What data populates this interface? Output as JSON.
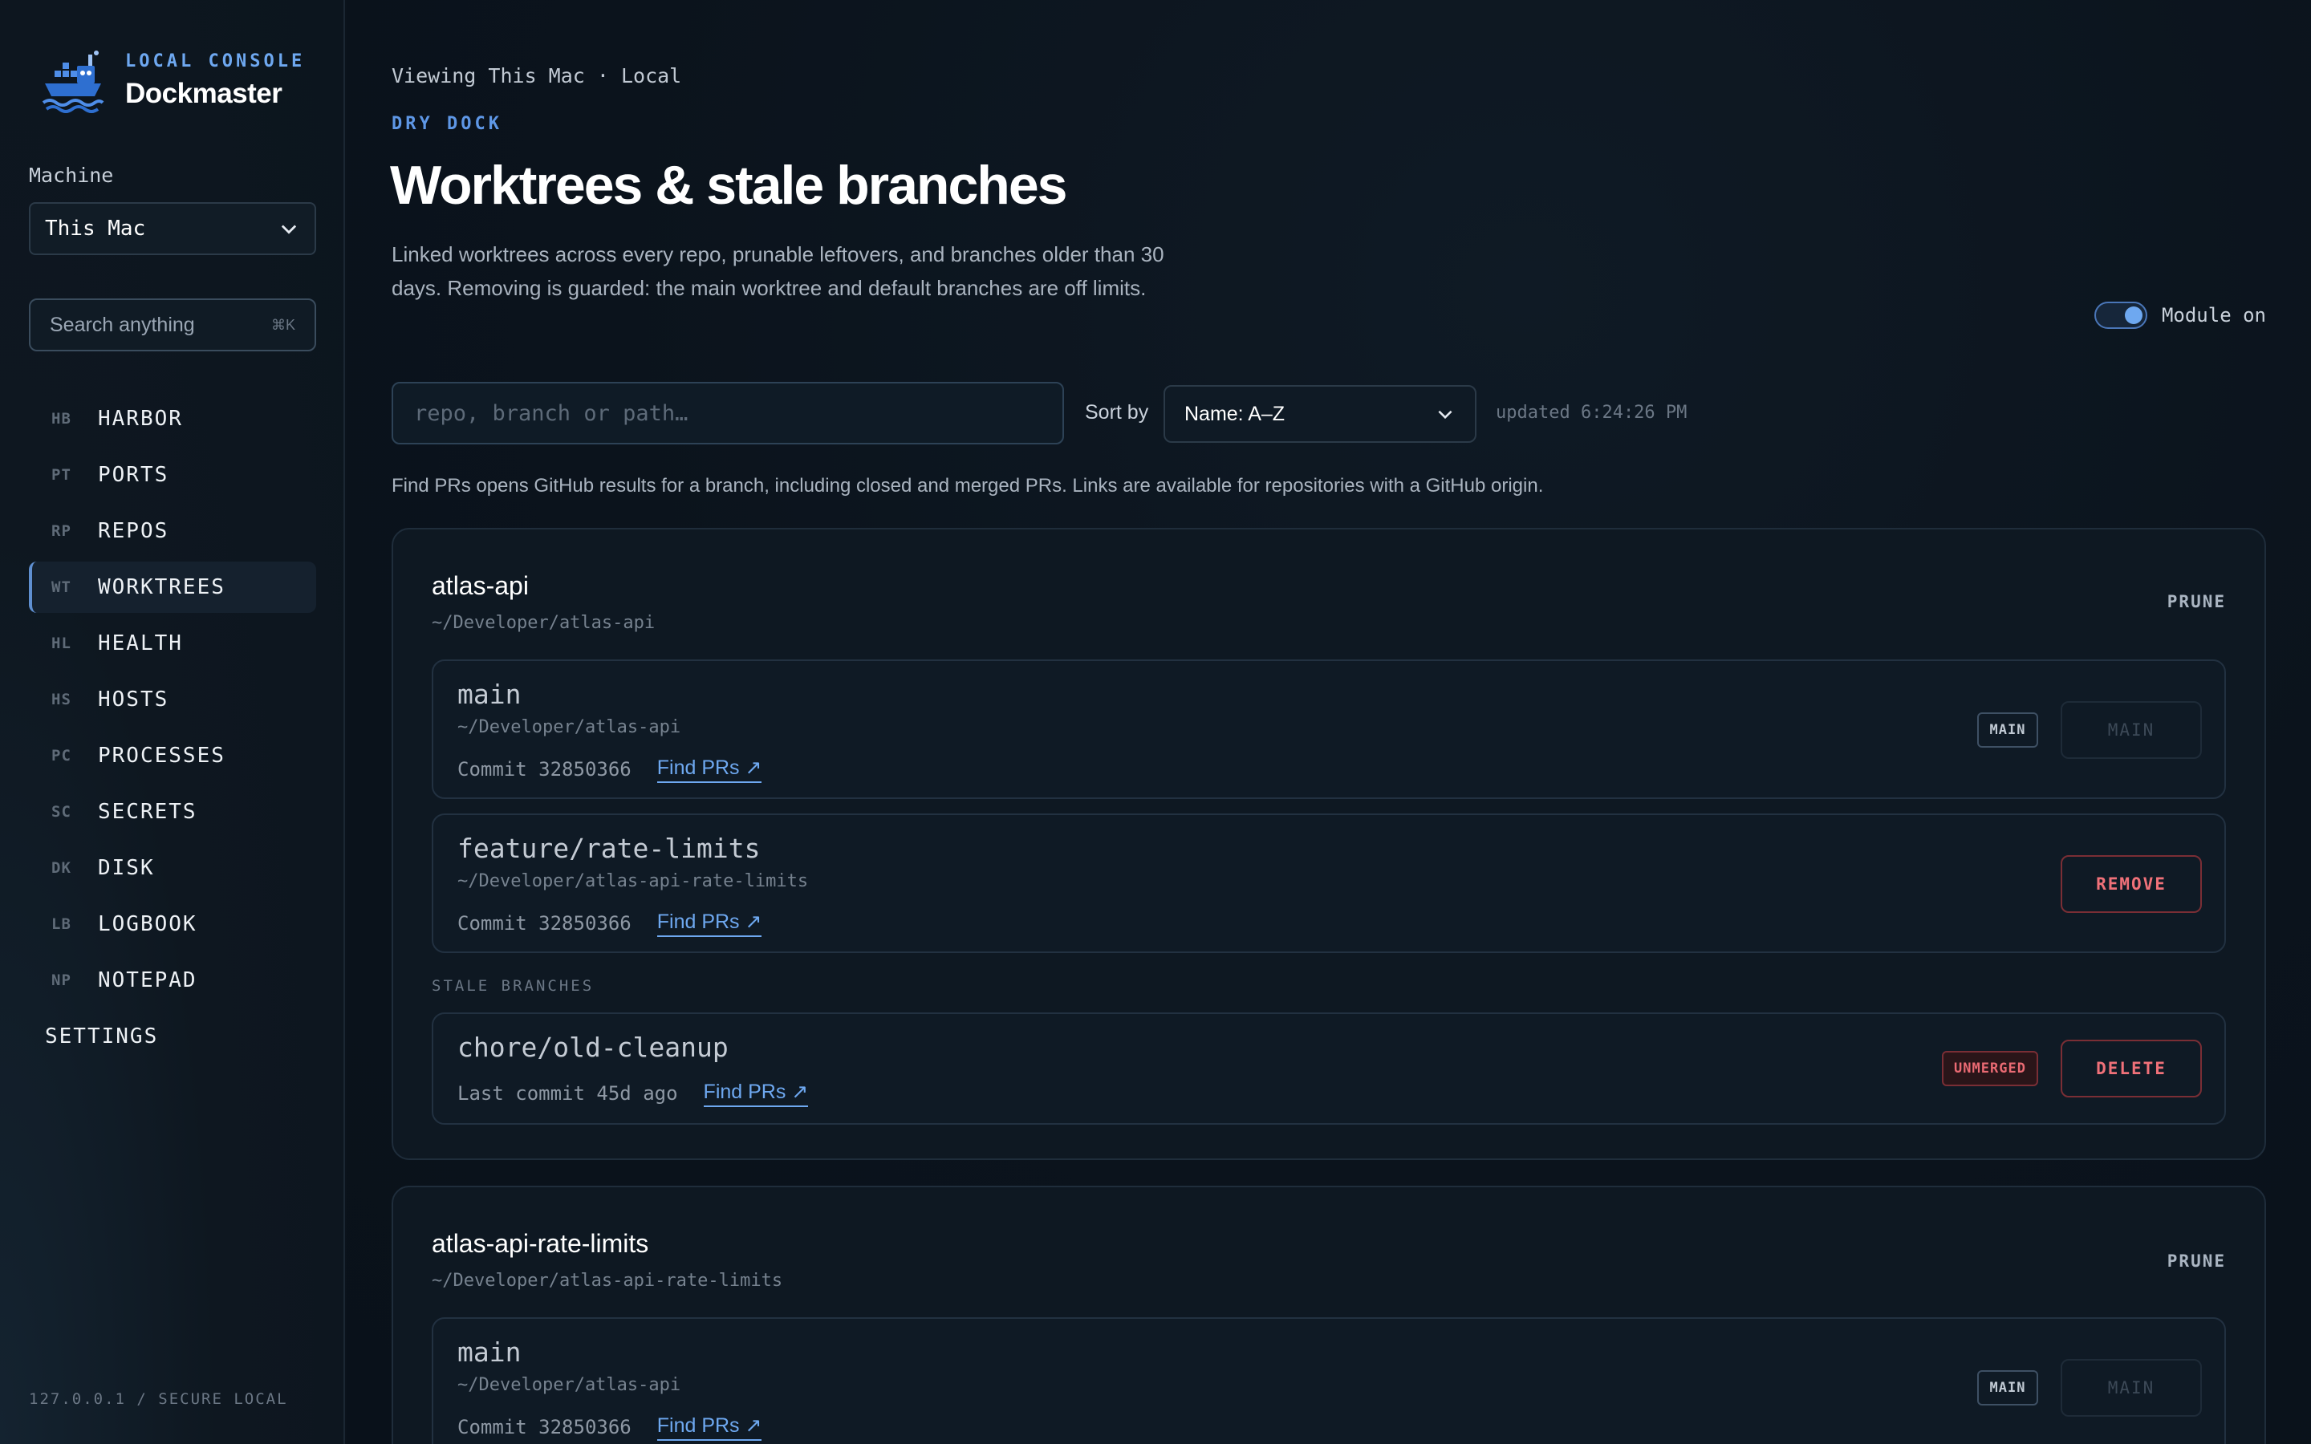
{
  "brand": {
    "kicker": "LOCAL CONSOLE",
    "name": "Dockmaster",
    "logo_icon": "boat-icon"
  },
  "machine": {
    "label": "Machine",
    "selected": "This Mac"
  },
  "search": {
    "placeholder": "Search anything",
    "shortcut": "⌘K"
  },
  "nav": {
    "items": [
      {
        "code": "HB",
        "label": "HARBOR"
      },
      {
        "code": "PT",
        "label": "PORTS"
      },
      {
        "code": "RP",
        "label": "REPOS"
      },
      {
        "code": "WT",
        "label": "WORKTREES",
        "active": true
      },
      {
        "code": "HL",
        "label": "HEALTH"
      },
      {
        "code": "HS",
        "label": "HOSTS"
      },
      {
        "code": "PC",
        "label": "PROCESSES"
      },
      {
        "code": "SC",
        "label": "SECRETS"
      },
      {
        "code": "DK",
        "label": "DISK"
      },
      {
        "code": "LB",
        "label": "LOGBOOK"
      },
      {
        "code": "NP",
        "label": "NOTEPAD"
      }
    ],
    "settings": "SETTINGS"
  },
  "footer": "127.0.0.1 / SECURE LOCAL",
  "page": {
    "breadcrumb": "Viewing This Mac · Local",
    "kicker": "DRY DOCK",
    "title": "Worktrees & stale branches",
    "description": "Linked worktrees across every repo, prunable leftovers, and branches older than 30 days. Removing is guarded: the main worktree and default branches are off limits.",
    "module_toggle": {
      "label": "Module on",
      "on": true
    },
    "filter": {
      "placeholder": "repo, branch or path…",
      "value": ""
    },
    "sort": {
      "label": "Sort by",
      "selected": "Name: A–Z"
    },
    "updated": "updated 6:24:26 PM",
    "info": "Find PRs opens GitHub results for a branch, including closed and merged PRs. Links are available for repositories with a GitHub origin."
  },
  "repos": [
    {
      "name": "atlas-api",
      "path": "~/Developer/atlas-api",
      "prune_label": "PRUNE",
      "worktrees": [
        {
          "branch": "main",
          "path": "~/Developer/atlas-api",
          "commit": "Commit 32850366",
          "find_prs": "Find PRs ↗",
          "badge": "MAIN",
          "action": "MAIN"
        },
        {
          "branch": "feature/rate-limits",
          "path": "~/Developer/atlas-api-rate-limits",
          "commit": "Commit 32850366",
          "find_prs": "Find PRs ↗",
          "action": "REMOVE"
        }
      ],
      "stale_label": "STALE BRANCHES",
      "stale": [
        {
          "branch": "chore/old-cleanup",
          "last_commit": "Last commit 45d ago",
          "find_prs": "Find PRs ↗",
          "badge": "UNMERGED",
          "action": "DELETE"
        }
      ]
    },
    {
      "name": "atlas-api-rate-limits",
      "path": "~/Developer/atlas-api-rate-limits",
      "prune_label": "PRUNE",
      "worktrees": [
        {
          "branch": "main",
          "path": "~/Developer/atlas-api",
          "commit": "Commit 32850366",
          "find_prs": "Find PRs ↗",
          "badge": "MAIN",
          "action": "MAIN"
        }
      ]
    }
  ],
  "colors": {
    "accent": "#6ea8f0",
    "danger": "#f07179",
    "background": "#0b131c"
  }
}
